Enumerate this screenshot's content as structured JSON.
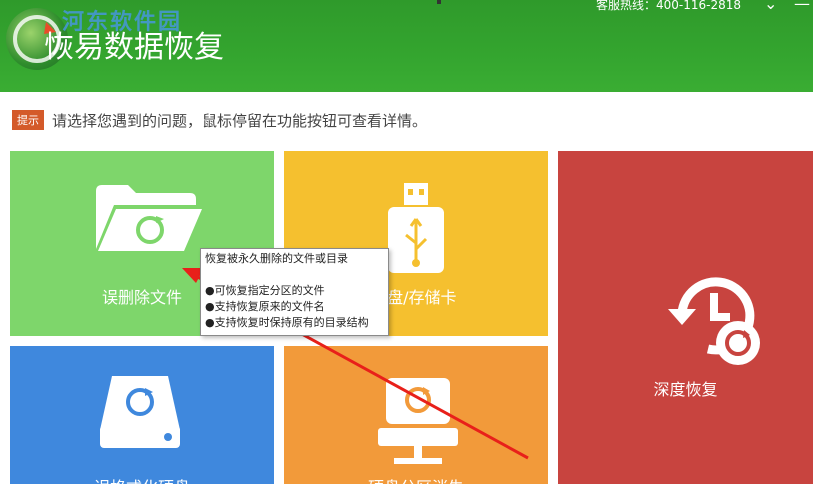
{
  "header": {
    "title": "恢易数据恢复",
    "watermark": "河东软件园",
    "hotline": "客服热线：400-116-2818",
    "minimize_glyph": "⌄",
    "close_glyph": "—"
  },
  "hint": {
    "badge": "提示",
    "text": "请选择您遇到的问题，鼠标停留在功能按钮可查看详情。"
  },
  "tiles": {
    "deleted_files": "误删除文件",
    "usb_card": "U盘/存储卡",
    "deep_recovery": "深度恢复",
    "formatted_disk": "误格式化硬盘",
    "partition_lost": "硬盘分区消失"
  },
  "tooltip": {
    "title": "恢复被永久删除的文件或目录",
    "lines": [
      "●可恢复指定分区的文件",
      "●支持恢复原来的文件名",
      "●支持恢复时保持原有的目录结构"
    ]
  },
  "colors": {
    "header": "#34a52f",
    "green": "#7ed66b",
    "yellow": "#f5c02f",
    "red": "#c8443f",
    "blue": "#3f88dd",
    "orange": "#f29a3a",
    "arrow": "#e8201a"
  }
}
